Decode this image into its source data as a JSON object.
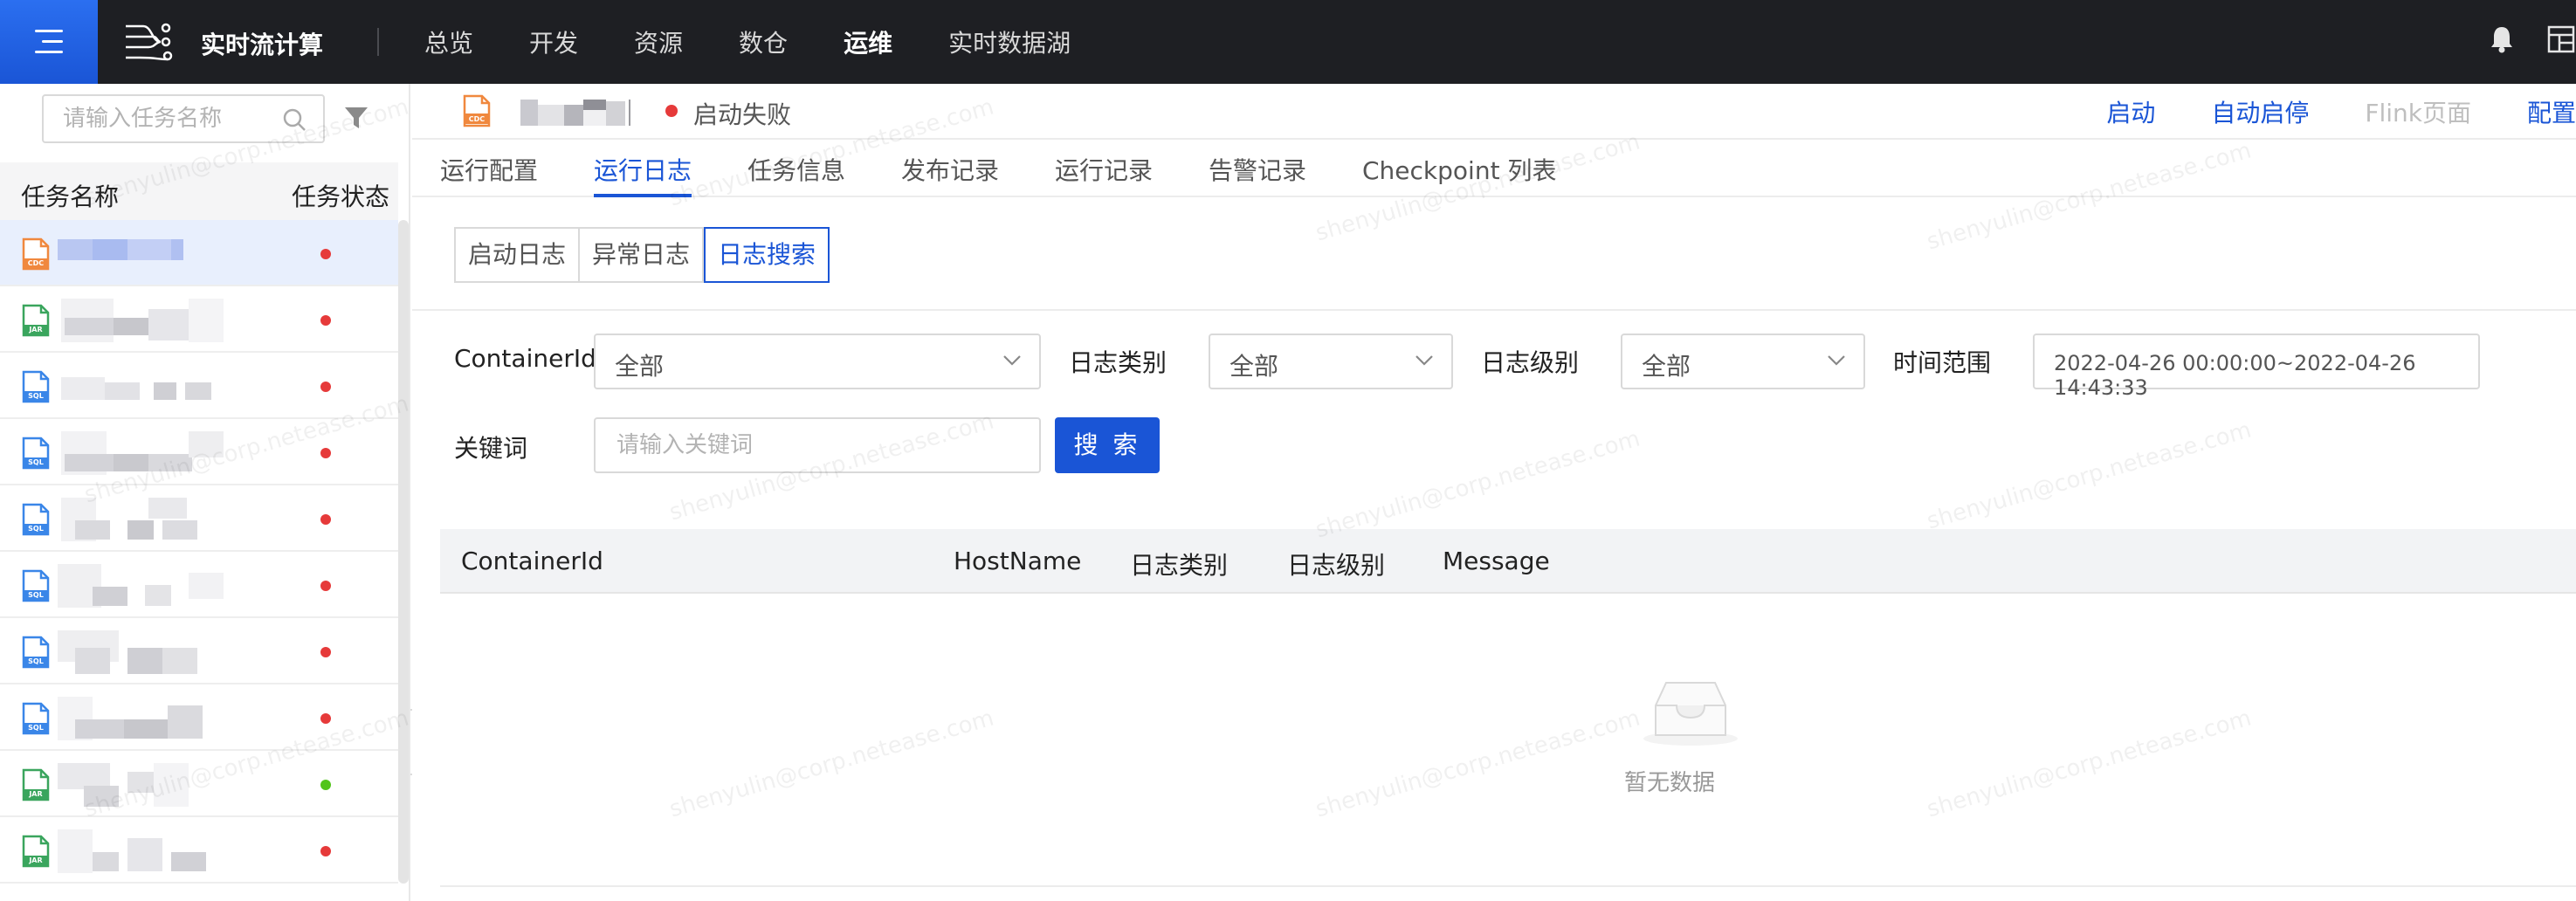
{
  "app": {
    "title": "实时流计算",
    "nav": [
      "总览",
      "开发",
      "资源",
      "数仓",
      "运维",
      "实时数据湖"
    ],
    "active_nav": "运维"
  },
  "sidebar": {
    "search_placeholder": "请输入任务名称",
    "col_name": "任务名称",
    "col_status": "任务状态",
    "tasks": [
      {
        "type": "CDC",
        "status": "failed",
        "selected": true
      },
      {
        "type": "JAR",
        "status": "failed"
      },
      {
        "type": "SQL",
        "status": "failed"
      },
      {
        "type": "SQL",
        "status": "failed"
      },
      {
        "type": "SQL",
        "status": "failed"
      },
      {
        "type": "SQL",
        "status": "failed"
      },
      {
        "type": "SQL",
        "status": "failed"
      },
      {
        "type": "SQL",
        "status": "failed"
      },
      {
        "type": "JAR",
        "status": "running"
      },
      {
        "type": "JAR",
        "status": "failed"
      }
    ]
  },
  "task_header": {
    "icon_type": "CDC",
    "status_text": "启动失败",
    "actions": {
      "start": "启动",
      "auto_restart": "自动启停",
      "flink_page": "Flink页面",
      "config": "配置"
    }
  },
  "tabs": [
    "运行配置",
    "运行日志",
    "任务信息",
    "发布记录",
    "运行记录",
    "告警记录",
    "Checkpoint 列表"
  ],
  "active_tab": "运行日志",
  "subtabs": [
    "启动日志",
    "异常日志",
    "日志搜索"
  ],
  "active_subtab": "日志搜索",
  "filters": {
    "container_label": "ContainerId",
    "container_value": "全部",
    "log_type_label": "日志类别",
    "log_type_value": "全部",
    "log_level_label": "日志级别",
    "log_level_value": "全部",
    "time_label": "时间范围",
    "time_value": "2022-04-26 00:00:00~2022-04-26 14:43:33",
    "keyword_label": "关键词",
    "keyword_placeholder": "请输入关键词",
    "search_button": "搜 索"
  },
  "table": {
    "columns": [
      "ContainerId",
      "HostName",
      "日志类别",
      "日志级别",
      "Message"
    ],
    "empty_text": "暂无数据"
  },
  "watermark": "shenyulin@corp.netease.com",
  "colors": {
    "accent": "#1a55d6",
    "topbar": "#1e1f23",
    "failed": "#e63a3a",
    "running": "#52c41a",
    "cdc": "#f0883e",
    "jar": "#3aa55d",
    "sql": "#3a86e8"
  }
}
